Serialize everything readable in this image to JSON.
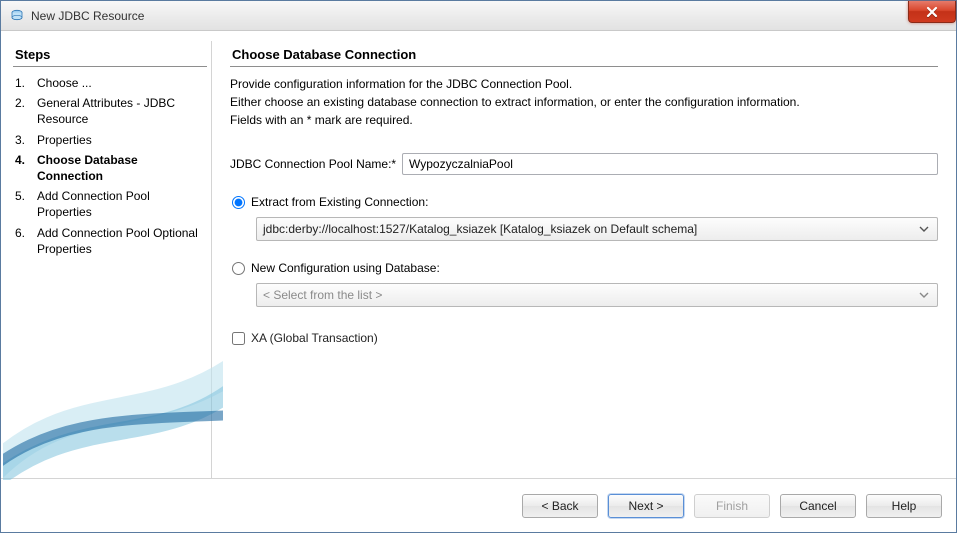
{
  "window": {
    "title": "New JDBC Resource"
  },
  "steps": {
    "heading": "Steps",
    "current_index": 3,
    "items": [
      {
        "num": "1.",
        "label": "Choose ..."
      },
      {
        "num": "2.",
        "label": "General Attributes - JDBC Resource"
      },
      {
        "num": "3.",
        "label": "Properties"
      },
      {
        "num": "4.",
        "label": "Choose Database Connection"
      },
      {
        "num": "5.",
        "label": "Add Connection Pool Properties"
      },
      {
        "num": "6.",
        "label": "Add Connection Pool Optional Properties"
      }
    ]
  },
  "main": {
    "heading": "Choose Database Connection",
    "desc_line1": "Provide configuration information for the JDBC Connection Pool.",
    "desc_line2": "Either choose an existing database connection to extract information, or enter the configuration information.",
    "desc_line3": "Fields with an * mark are required.",
    "pool_name_label": "JDBC Connection Pool Name:*",
    "pool_name_value": "WypozyczalniaPool",
    "radio_extract_label": "Extract from Existing Connection:",
    "extract_connection_value": "jdbc:derby://localhost:1527/Katalog_ksiazek [Katalog_ksiazek on Default schema]",
    "radio_newconfig_label": "New Configuration using Database:",
    "newconfig_placeholder": "< Select from the list >",
    "radio_selected": "extract",
    "xa_label": "XA (Global Transaction)",
    "xa_checked": false
  },
  "buttons": {
    "back": "< Back",
    "next": "Next >",
    "finish": "Finish",
    "cancel": "Cancel",
    "help": "Help"
  }
}
